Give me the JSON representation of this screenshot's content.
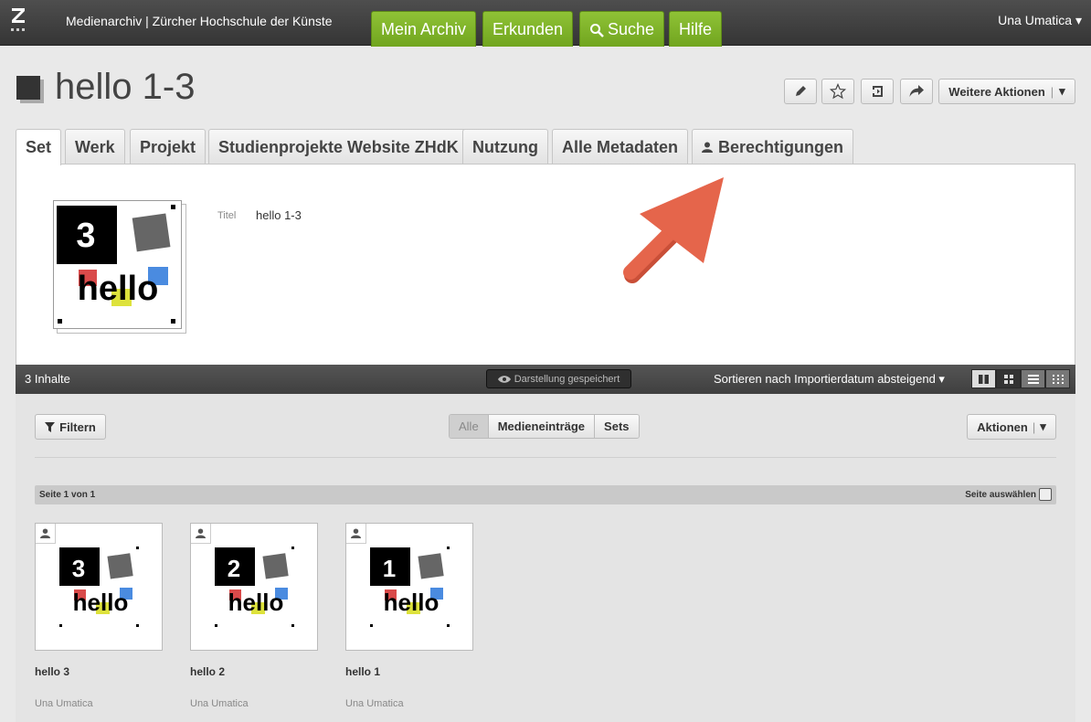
{
  "topbar": {
    "brand": "Medienarchiv | Zürcher Hochschule der Künste",
    "nav": [
      "Mein Archiv",
      "Erkunden",
      "Suche",
      "Hilfe"
    ],
    "user": "Una Umatica ▾"
  },
  "page": {
    "title": "hello 1-3",
    "more_actions": "Weitere Aktionen"
  },
  "tabs": [
    "Set",
    "Werk",
    "Projekt",
    "Studienprojekte Website ZHdK",
    "Nutzung",
    "Alle Metadaten",
    "Berechtigungen"
  ],
  "metadata": {
    "label": "Titel",
    "value": "hello 1-3"
  },
  "thumbnail": {
    "digit": "3",
    "word": "hello"
  },
  "toolbar": {
    "count": "3 Inhalte",
    "saved": "Darstellung gespeichert",
    "sort": "Sortieren nach Importierdatum absteigend ▾"
  },
  "filters": {
    "filter_label": "Filtern",
    "segments": [
      "Alle",
      "Medieneinträge",
      "Sets"
    ],
    "actions": "Aktionen"
  },
  "pagination": {
    "page": "Seite 1 von 1",
    "select_page": "Seite auswählen"
  },
  "items": [
    {
      "title": "hello 3",
      "owner": "Una Umatica",
      "digit": "3"
    },
    {
      "title": "hello 2",
      "owner": "Una Umatica",
      "digit": "2"
    },
    {
      "title": "hello 1",
      "owner": "Una Umatica",
      "digit": "1"
    }
  ],
  "colors": {
    "nav_green": "#7fb52a",
    "arrow": "#e5654b"
  }
}
